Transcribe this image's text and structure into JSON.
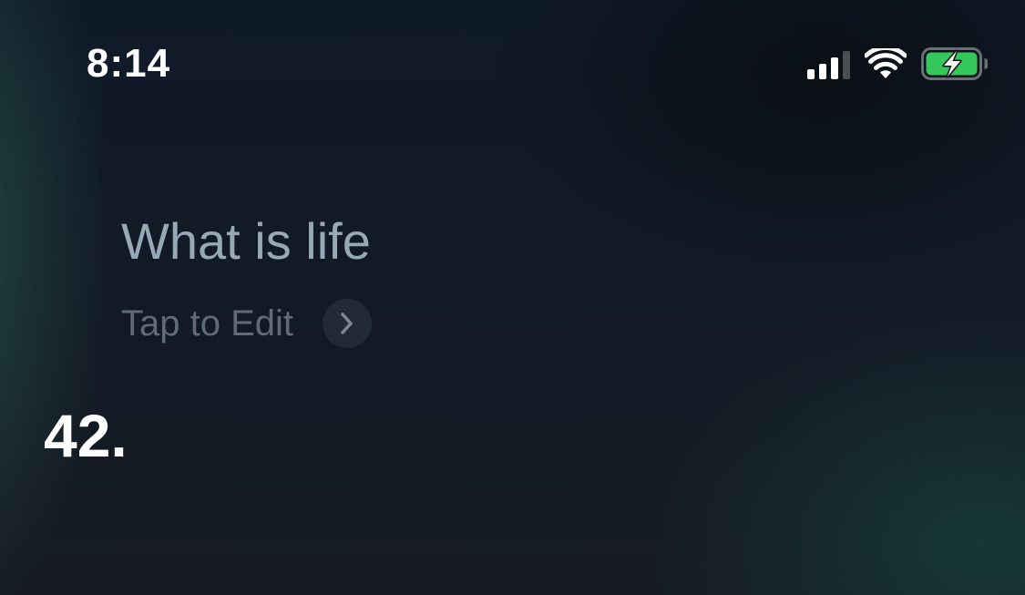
{
  "status_bar": {
    "time": "8:14",
    "signal_icon": "cellular-signal-icon",
    "wifi_icon": "wifi-icon",
    "battery_icon": "battery-charging-icon",
    "battery_color": "#34c759"
  },
  "siri": {
    "query": "What is life",
    "edit_label": "Tap to Edit",
    "edit_icon": "chevron-right-icon",
    "answer": "42."
  }
}
